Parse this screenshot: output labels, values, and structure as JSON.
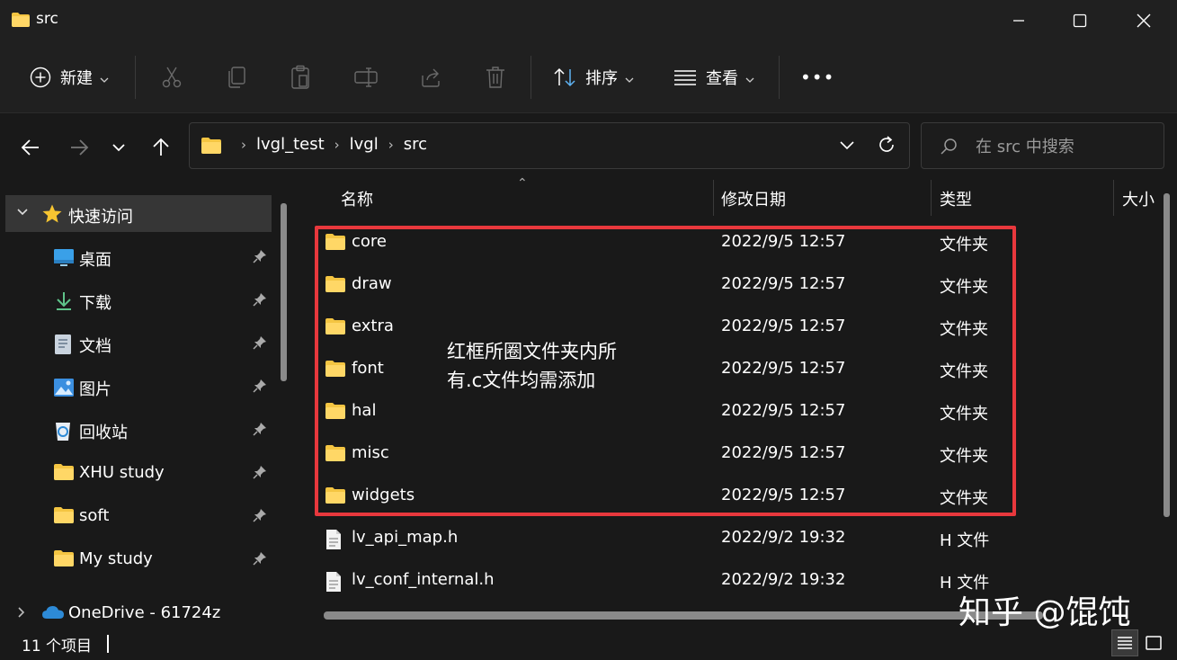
{
  "window": {
    "title": "src"
  },
  "toolbar": {
    "new_label": "新建",
    "sort_label": "排序",
    "view_label": "查看",
    "more_label": "•••"
  },
  "address": {
    "crumbs": [
      "lvgl_test",
      "lvgl",
      "src"
    ]
  },
  "search": {
    "placeholder": "在 src 中搜索"
  },
  "sidebar": {
    "quick_access_label": "快速访问",
    "items": [
      {
        "label": "桌面",
        "icon": "desktop-icon"
      },
      {
        "label": "下载",
        "icon": "download-icon"
      },
      {
        "label": "文档",
        "icon": "document-icon"
      },
      {
        "label": "图片",
        "icon": "pictures-icon"
      },
      {
        "label": "回收站",
        "icon": "recycle-bin-icon"
      },
      {
        "label": "XHU study",
        "icon": "folder-icon"
      },
      {
        "label": "soft",
        "icon": "folder-icon"
      },
      {
        "label": "My study",
        "icon": "folder-icon"
      }
    ],
    "onedrive_label": "OneDrive - 61724z"
  },
  "columns": {
    "name": "名称",
    "date": "修改日期",
    "type": "类型",
    "size": "大小"
  },
  "files": [
    {
      "name": "core",
      "date": "2022/9/5 12:57",
      "type": "文件夹",
      "kind": "folder"
    },
    {
      "name": "draw",
      "date": "2022/9/5 12:57",
      "type": "文件夹",
      "kind": "folder"
    },
    {
      "name": "extra",
      "date": "2022/9/5 12:57",
      "type": "文件夹",
      "kind": "folder"
    },
    {
      "name": "font",
      "date": "2022/9/5 12:57",
      "type": "文件夹",
      "kind": "folder"
    },
    {
      "name": "hal",
      "date": "2022/9/5 12:57",
      "type": "文件夹",
      "kind": "folder"
    },
    {
      "name": "misc",
      "date": "2022/9/5 12:57",
      "type": "文件夹",
      "kind": "folder"
    },
    {
      "name": "widgets",
      "date": "2022/9/5 12:57",
      "type": "文件夹",
      "kind": "folder"
    },
    {
      "name": "lv_api_map.h",
      "date": "2022/9/2 19:32",
      "type": "H 文件",
      "kind": "file"
    },
    {
      "name": "lv_conf_internal.h",
      "date": "2022/9/2 19:32",
      "type": "H 文件",
      "kind": "file"
    }
  ],
  "annotation": {
    "line1": "红框所圈文件夹内所",
    "line2": "有.c文件均需添加"
  },
  "watermark": "知乎 @馄饨",
  "status": {
    "count_text": "11 个项目"
  },
  "colors": {
    "highlight_box": "#e8383d",
    "folder": "#f4c542",
    "background": "#191919"
  }
}
